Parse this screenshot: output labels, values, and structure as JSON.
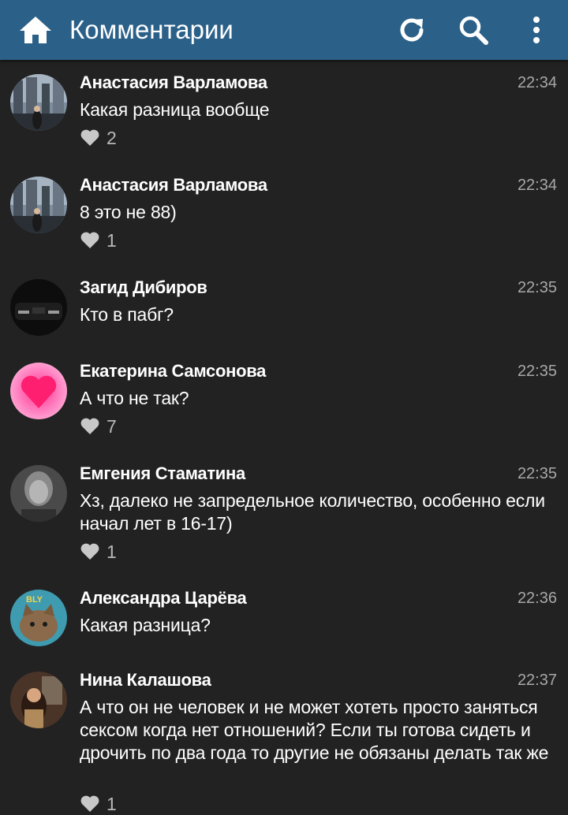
{
  "header": {
    "title": "Комментарии",
    "background": "#2b6088",
    "icons": [
      "home-icon",
      "refresh-icon",
      "search-icon",
      "more-vertical-icon"
    ]
  },
  "comments": [
    {
      "author": "Анастасия Варламова",
      "time": "22:34",
      "text": "Какая разница вообще",
      "likes": "2"
    },
    {
      "author": "Анастасия Варламова",
      "time": "22:34",
      "text": "8 это не 88)",
      "likes": "1"
    },
    {
      "author": "Загид Дибиров",
      "time": "22:35",
      "text": "Кто в пабг?",
      "likes": ""
    },
    {
      "author": "Екатерина Самсонова",
      "time": "22:35",
      "text": "А что не так?",
      "likes": "7"
    },
    {
      "author": "Емгения Стаматина",
      "time": "22:35",
      "text": "Хз, далеко не запредельное количество, особенно если начал лет в 16-17)",
      "likes": "1"
    },
    {
      "author": "Александра Царёва",
      "time": "22:36",
      "text": "Какая разница?",
      "likes": ""
    },
    {
      "author": "Нина Калашова",
      "time": "22:37",
      "text": "А что он не человек и не может хотеть просто заняться сексом когда нет отношений? Если ты готова сидеть и дрочить по два года то другие не обязаны делать так же",
      "likes": "1"
    }
  ],
  "avatar_badge": "BLY"
}
